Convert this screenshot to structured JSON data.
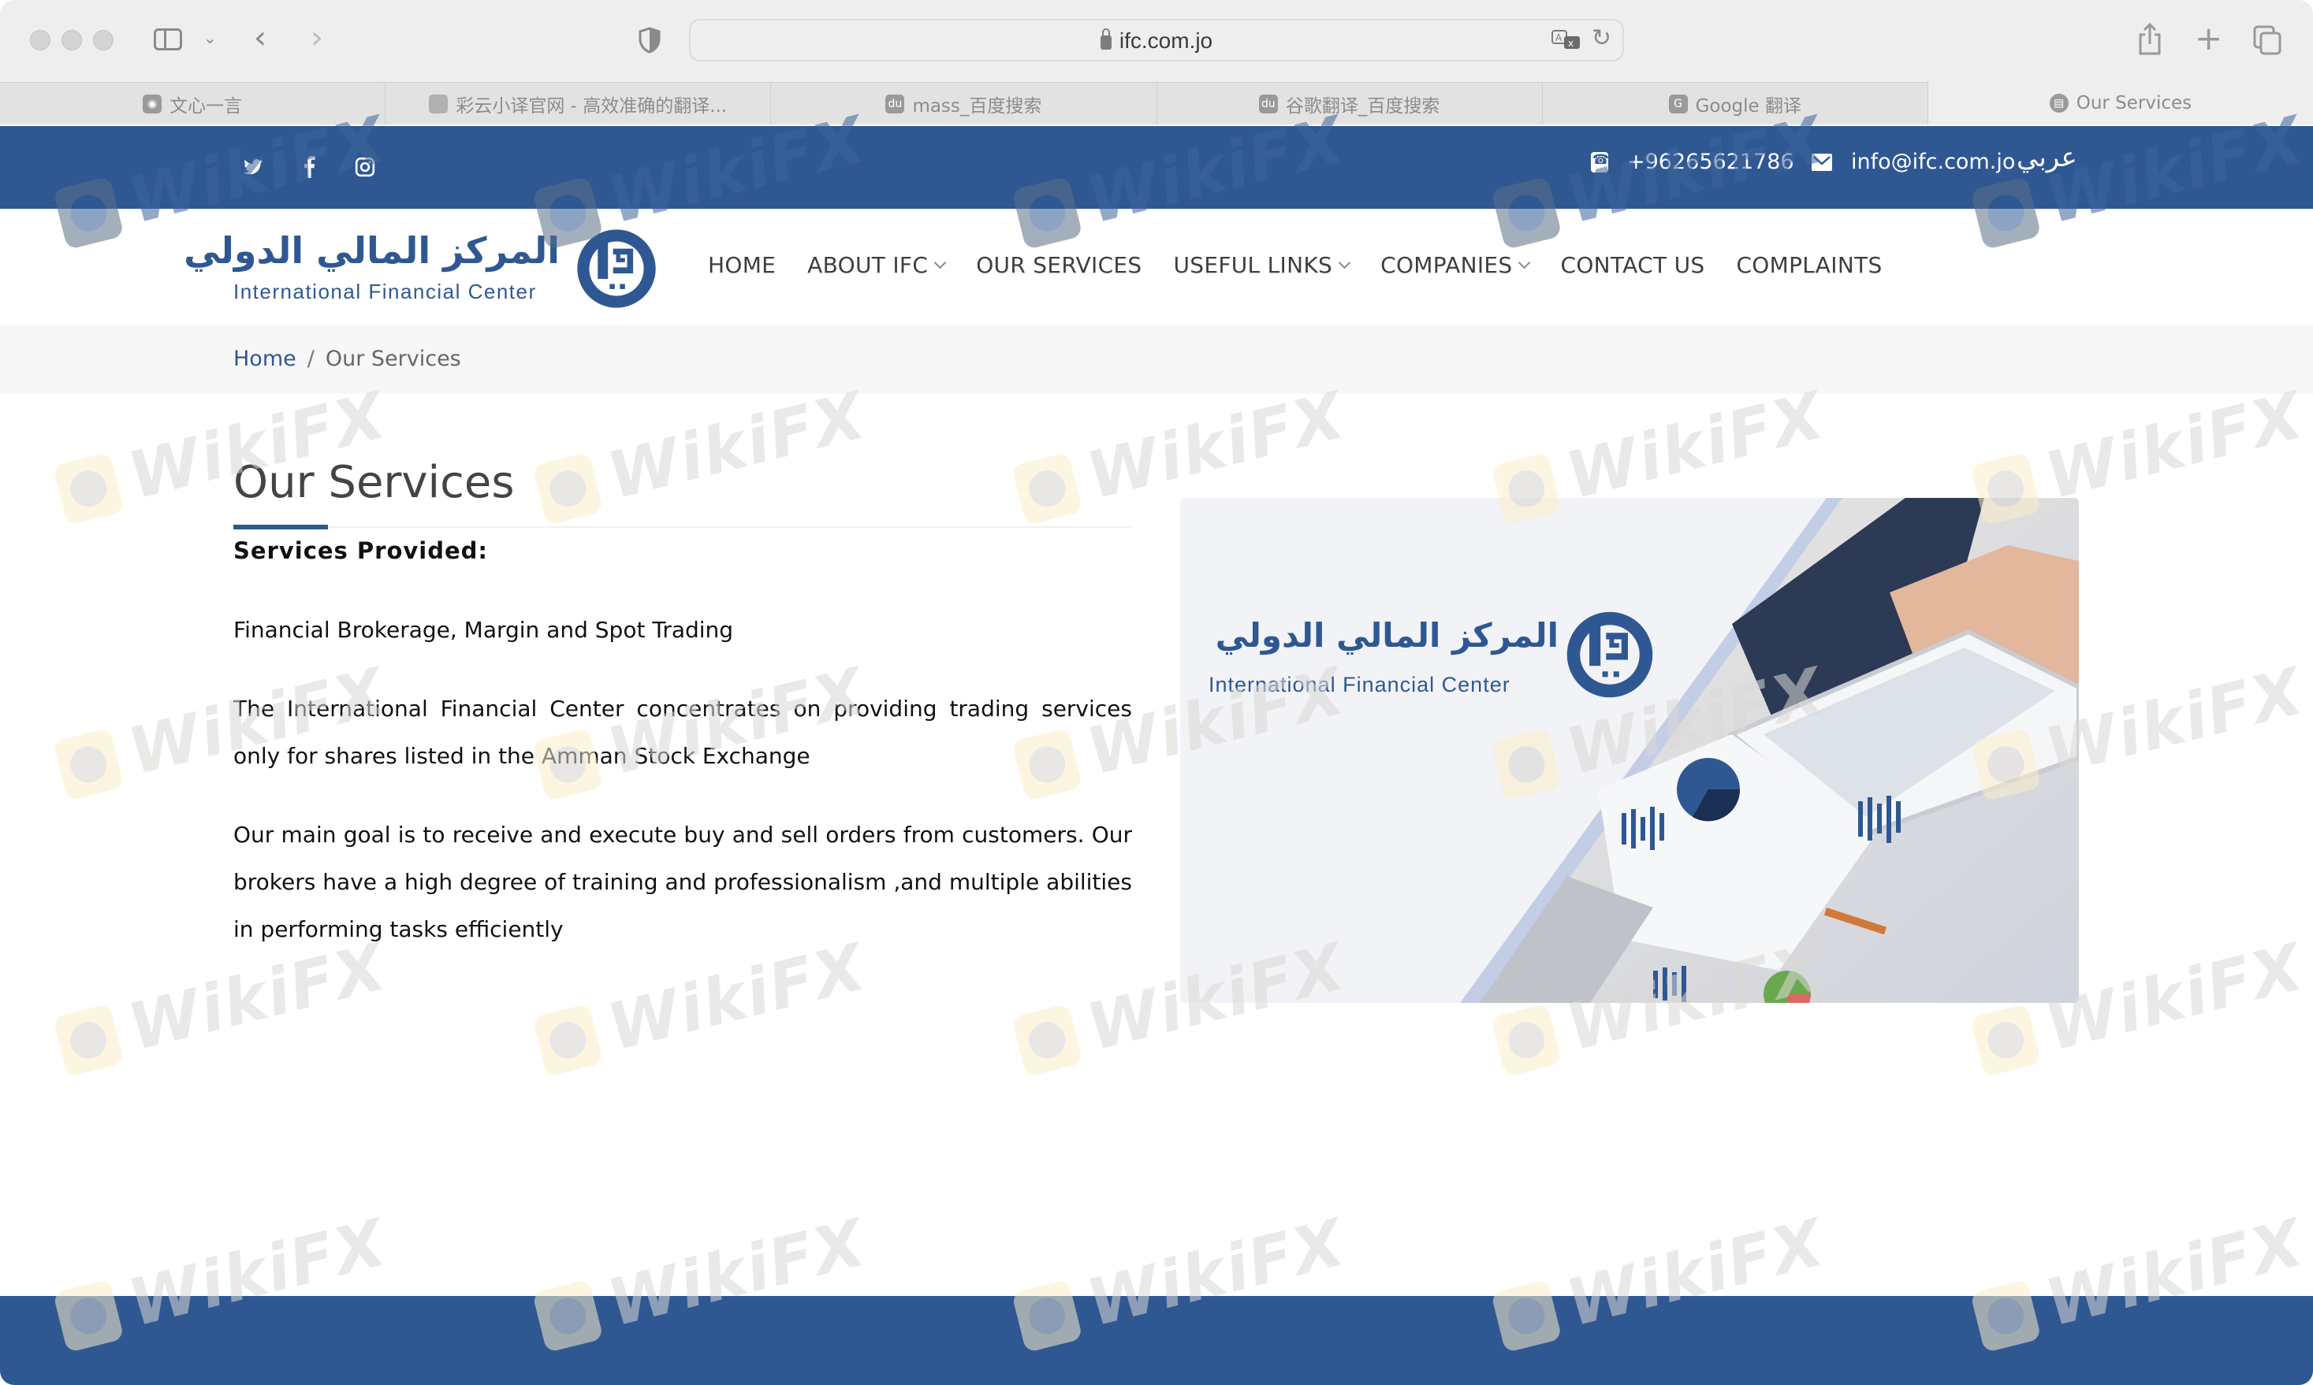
{
  "browser": {
    "url": "ifc.com.jo",
    "tabs": [
      {
        "label": "文心一言",
        "icon": "wenxin-icon",
        "active": false
      },
      {
        "label": "彩云小译官网 - 高效准确的翻译...",
        "icon": "caiyun-icon",
        "active": false
      },
      {
        "label": "mass_百度搜索",
        "icon": "baidu-icon",
        "active": false
      },
      {
        "label": "谷歌翻译_百度搜索",
        "icon": "baidu-icon",
        "active": false
      },
      {
        "label": "Google 翻译",
        "icon": "google-translate-icon",
        "active": false
      },
      {
        "label": "Our Services",
        "icon": "ifc-icon",
        "active": true
      }
    ]
  },
  "topbar": {
    "social": [
      "twitter-icon",
      "facebook-icon",
      "instagram-icon"
    ],
    "phone": "+96265621786",
    "email": "info@ifc.com.jo",
    "language": "عربي"
  },
  "header": {
    "logo_ar": "المركز المالي الدولي",
    "logo_en": "International Financial Center",
    "nav": [
      {
        "label": "HOME",
        "dropdown": false
      },
      {
        "label": "ABOUT IFC",
        "dropdown": true
      },
      {
        "label": "OUR SERVICES",
        "dropdown": false
      },
      {
        "label": "USEFUL LINKS",
        "dropdown": true
      },
      {
        "label": "COMPANIES",
        "dropdown": true
      },
      {
        "label": "CONTACT US",
        "dropdown": false
      },
      {
        "label": "COMPLAINTS",
        "dropdown": false
      }
    ]
  },
  "breadcrumb": {
    "home": "Home",
    "separator": "/",
    "current": "Our Services"
  },
  "main": {
    "title": "Our Services",
    "subheading": "Services Provided:",
    "paragraphs": [
      "Financial Brokerage, Margin and Spot Trading",
      "The International Financial Center concentrates on providing trading services only for shares listed in the Amman Stock Exchange",
      "Our main goal is to receive and execute buy and sell orders from customers. Our brokers have a high degree of training and professionalism ,and multiple abilities in performing tasks efficiently"
    ],
    "image": {
      "logo_ar": "المركز المالي الدولي",
      "logo_en": "International Financial Center"
    }
  },
  "watermark": "WikiFX",
  "colors": {
    "brand_blue": "#2f5893",
    "breadcrumb_bg": "#f7f7f7",
    "text": "#111111",
    "title": "#444444"
  }
}
